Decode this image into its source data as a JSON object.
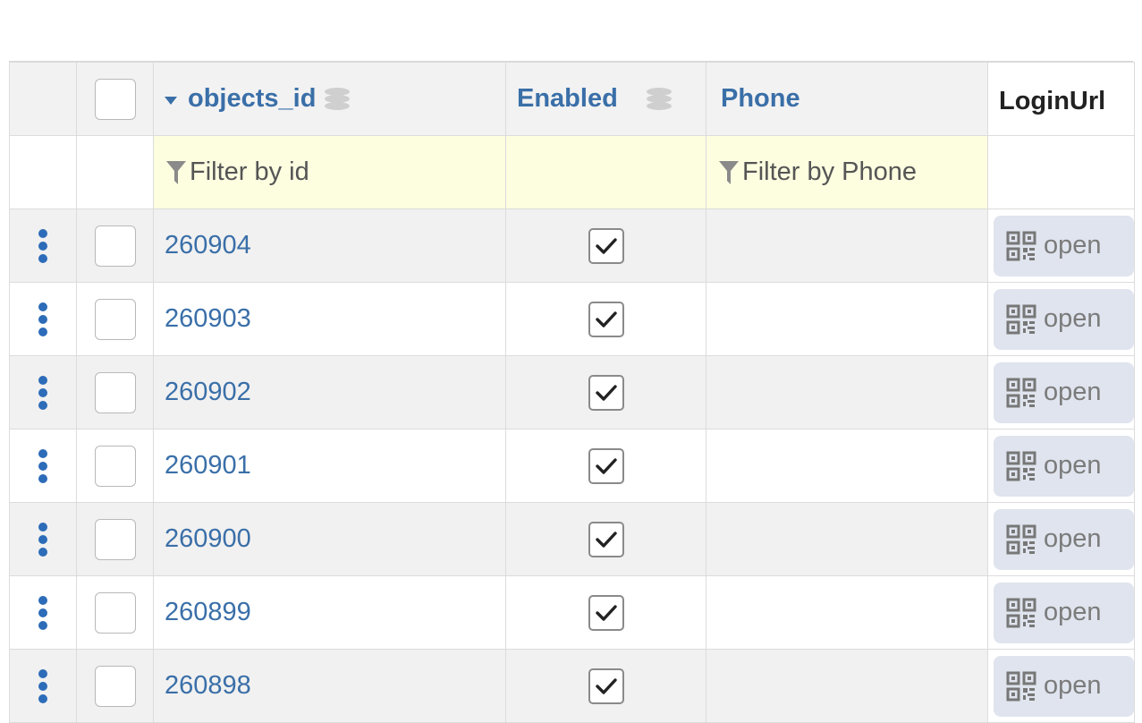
{
  "columns": {
    "objects_id": "objects_id",
    "enabled": "Enabled",
    "phone": "Phone",
    "login_url": "LoginUrl"
  },
  "filters": {
    "id_placeholder": "Filter by id",
    "phone_placeholder": "Filter by Phone"
  },
  "rows": [
    {
      "id": "260904",
      "enabled": true,
      "phone": "",
      "login": "open"
    },
    {
      "id": "260903",
      "enabled": true,
      "phone": "",
      "login": "open"
    },
    {
      "id": "260902",
      "enabled": true,
      "phone": "",
      "login": "open"
    },
    {
      "id": "260901",
      "enabled": true,
      "phone": "",
      "login": "open"
    },
    {
      "id": "260900",
      "enabled": true,
      "phone": "",
      "login": "open"
    },
    {
      "id": "260899",
      "enabled": true,
      "phone": "",
      "login": "open"
    },
    {
      "id": "260898",
      "enabled": true,
      "phone": "",
      "login": "open"
    }
  ],
  "colors": {
    "link": "#3a6fa8",
    "filter_bg": "#fdfde0",
    "menu_dots": "#2d6cb8"
  },
  "icons": {
    "sort": "caret-down-icon",
    "db": "database-icon",
    "filter": "funnel-icon",
    "qr": "qr-code-icon",
    "menu": "vertical-dots-icon",
    "check": "checkmark-icon"
  }
}
